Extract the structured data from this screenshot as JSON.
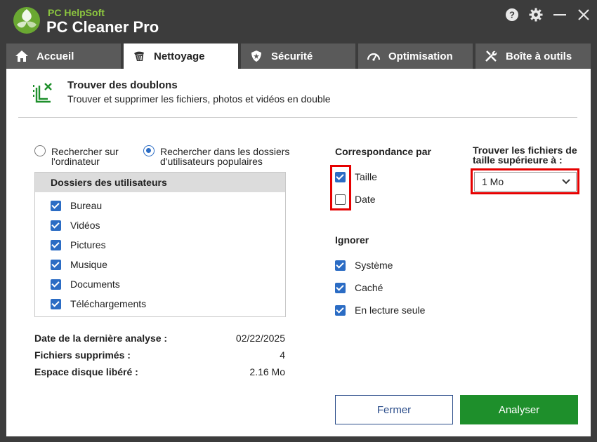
{
  "app": {
    "brand_top": "PC HelpSoft",
    "title": "PC Cleaner Pro",
    "controls": [
      "help-icon",
      "gear-icon",
      "minimize-icon",
      "close-icon"
    ]
  },
  "tabs": [
    {
      "label": "Accueil",
      "icon": "home-icon",
      "active": false
    },
    {
      "label": "Nettoyage",
      "icon": "broom-icon",
      "active": true
    },
    {
      "label": "Sécurité",
      "icon": "shield-icon",
      "active": false
    },
    {
      "label": "Optimisation",
      "icon": "speedometer-icon",
      "active": false
    },
    {
      "label": "Boîte à outils",
      "icon": "tools-icon",
      "active": false
    }
  ],
  "header": {
    "title": "Trouver des doublons",
    "subtitle": "Trouver et supprimer les fichiers, photos et vidéos en double"
  },
  "scope": {
    "option1": "Rechercher sur l'ordinateur",
    "option2": "Rechercher dans les dossiers d'utilisateurs populaires",
    "selected": 2
  },
  "folders": {
    "title": "Dossiers des utilisateurs",
    "items": [
      {
        "label": "Bureau",
        "checked": true
      },
      {
        "label": "Vidéos",
        "checked": true
      },
      {
        "label": "Pictures",
        "checked": true
      },
      {
        "label": "Musique",
        "checked": true
      },
      {
        "label": "Documents",
        "checked": true
      },
      {
        "label": "Téléchargements",
        "checked": true
      }
    ]
  },
  "stats": {
    "last_scan_label": "Date de la dernière analyse :",
    "last_scan_value": "02/22/2025",
    "deleted_label": "Fichiers supprimés :",
    "deleted_value": "4",
    "freed_label": "Espace disque libéré :",
    "freed_value": "2.16 Mo"
  },
  "match": {
    "title": "Correspondance par",
    "items": [
      {
        "label": "Taille",
        "checked": true
      },
      {
        "label": "Date",
        "checked": false
      }
    ]
  },
  "ignore": {
    "title": "Ignorer",
    "items": [
      {
        "label": "Système",
        "checked": true
      },
      {
        "label": "Caché",
        "checked": true
      },
      {
        "label": "En lecture seule",
        "checked": true
      }
    ]
  },
  "size_filter": {
    "label": "Trouver les fichiers de taille supérieure à :",
    "value": "1 Mo"
  },
  "buttons": {
    "close": "Fermer",
    "analyze": "Analyser"
  },
  "colors": {
    "accent": "#2b6cc4",
    "green": "#1e8f2b",
    "highlight": "#e60000",
    "titlebar": "#3c3c3c"
  }
}
